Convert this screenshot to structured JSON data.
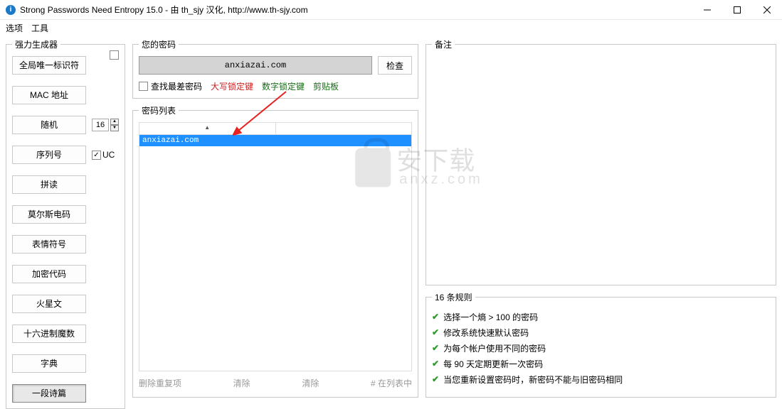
{
  "window": {
    "title": "Strong Passwords Need Entropy 15.0 - 由 th_sjy 汉化, http://www.th-sjy.com"
  },
  "menu": {
    "options": "选项",
    "tools": "工具"
  },
  "generator": {
    "title": "强力生成器",
    "guid": "全局唯一标识符",
    "mac": "MAC 地址",
    "random": "随机",
    "random_len": "16",
    "serial": "序列号",
    "uc_label": "UC",
    "pinyin": "拼读",
    "morse": "莫尔斯电码",
    "emoji": "表情符号",
    "crypto": "加密代码",
    "martian": "火星文",
    "hexmagic": "十六进制魔数",
    "dict": "字典",
    "poem": "一段诗篇"
  },
  "password": {
    "title": "您的密码",
    "value": "anxiazai.com",
    "check": "检查",
    "worst_chk": "查找最差密码",
    "caps": "大写锁定键",
    "numlock": "数字锁定键",
    "clipboard": "剪贴板"
  },
  "pwdlist": {
    "title": "密码列表",
    "item0": "anxiazai.com",
    "footer_dup": "删除重复项",
    "footer_clear1": "清除",
    "footer_clear2": "清除",
    "footer_count": "# 在列表中"
  },
  "notes": {
    "title": "备注"
  },
  "rules": {
    "title": "16 条规则",
    "r1": "选择一个熵 > 100 的密码",
    "r2": "修改系统快速默认密码",
    "r3": "为每个帐户使用不同的密码",
    "r4": "每 90 天定期更新一次密码",
    "r5": "当您重新设置密码时，新密码不能与旧密码相同"
  },
  "watermark": {
    "main": "安下载",
    "sub": "anxz.com"
  }
}
